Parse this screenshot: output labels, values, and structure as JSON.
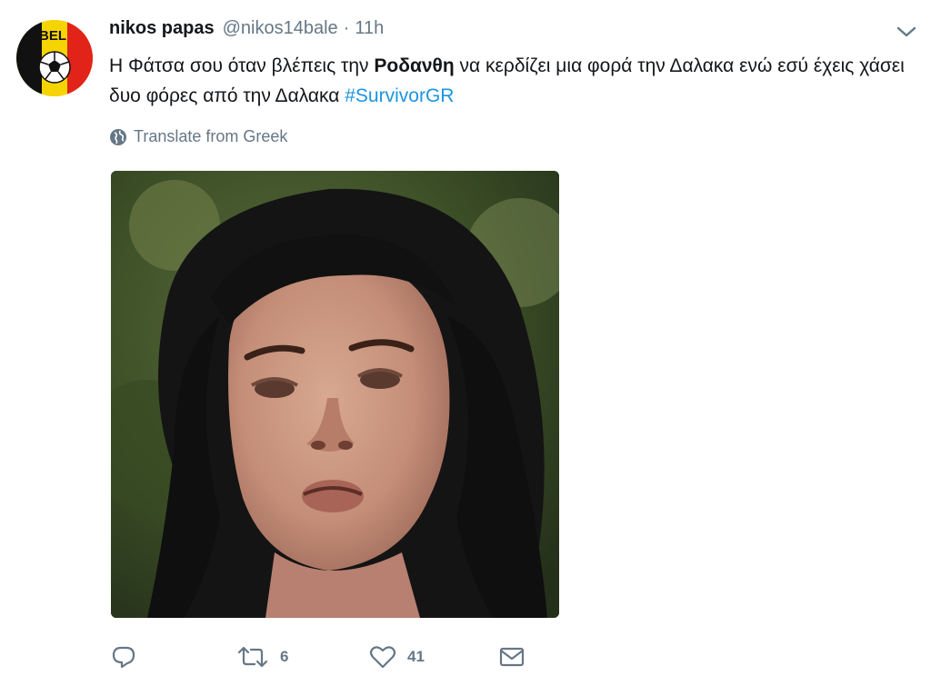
{
  "tweet": {
    "author_name": "nikos papas",
    "author_handle": "@nikos14bale",
    "separator": "·",
    "time": "11h",
    "avatar_text": "BEL",
    "text_part1": "Η Φάτσα σου όταν βλέπεις την ",
    "text_bold": "Ροδανθη",
    "text_part2": " να κερδίζει μια φορά την Δαλακα ενώ εσύ έχεις χάσει δυο φόρες από την Δαλακα ",
    "hashtag": "#SurvivorGR",
    "translate_label": "Translate from Greek"
  },
  "actions": {
    "reply_count": "",
    "retweet_count": "6",
    "like_count": "41"
  },
  "icons": {
    "caret": "chevron-down-icon",
    "translate": "globe-icon",
    "reply": "reply-icon",
    "retweet": "retweet-icon",
    "like": "heart-icon",
    "message": "envelope-icon"
  },
  "colors": {
    "text": "#14171a",
    "secondary": "#657786",
    "link": "#1b95e0"
  }
}
